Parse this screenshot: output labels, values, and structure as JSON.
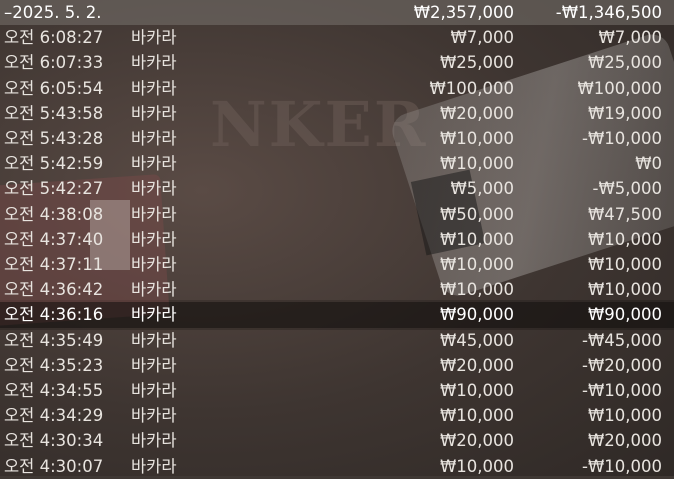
{
  "header": {
    "date": "–2025. 5. 2.",
    "bet_total": "₩2,357,000",
    "win_total": "-₩1,346,500"
  },
  "background_text": "NKER",
  "rows": [
    {
      "time": "오전 6:08:27",
      "game": "바카라",
      "bet": "₩7,000",
      "win": "₩7,000"
    },
    {
      "time": "오전 6:07:33",
      "game": "바카라",
      "bet": "₩25,000",
      "win": "₩25,000"
    },
    {
      "time": "오전 6:05:54",
      "game": "바카라",
      "bet": "₩100,000",
      "win": "₩100,000"
    },
    {
      "time": "오전 5:43:58",
      "game": "바카라",
      "bet": "₩20,000",
      "win": "₩19,000"
    },
    {
      "time": "오전 5:43:28",
      "game": "바카라",
      "bet": "₩10,000",
      "win": "-₩10,000"
    },
    {
      "time": "오전 5:42:59",
      "game": "바카라",
      "bet": "₩10,000",
      "win": "₩0"
    },
    {
      "time": "오전 5:42:27",
      "game": "바카라",
      "bet": "₩5,000",
      "win": "-₩5,000"
    },
    {
      "time": "오전 4:38:08",
      "game": "바카라",
      "bet": "₩50,000",
      "win": "₩47,500"
    },
    {
      "time": "오전 4:37:40",
      "game": "바카라",
      "bet": "₩10,000",
      "win": "₩10,000"
    },
    {
      "time": "오전 4:37:11",
      "game": "바카라",
      "bet": "₩10,000",
      "win": "₩10,000"
    },
    {
      "time": "오전 4:36:42",
      "game": "바카라",
      "bet": "₩10,000",
      "win": "₩10,000"
    },
    {
      "time": "오전 4:36:16",
      "game": "바카라",
      "bet": "₩90,000",
      "win": "₩90,000"
    },
    {
      "time": "오전 4:35:49",
      "game": "바카라",
      "bet": "₩45,000",
      "win": "-₩45,000"
    },
    {
      "time": "오전 4:35:23",
      "game": "바카라",
      "bet": "₩20,000",
      "win": "-₩20,000"
    },
    {
      "time": "오전 4:34:55",
      "game": "바카라",
      "bet": "₩10,000",
      "win": "-₩10,000"
    },
    {
      "time": "오전 4:34:29",
      "game": "바카라",
      "bet": "₩10,000",
      "win": "₩10,000"
    },
    {
      "time": "오전 4:30:34",
      "game": "바카라",
      "bet": "₩20,000",
      "win": "₩20,000"
    },
    {
      "time": "오전 4:30:07",
      "game": "바카라",
      "bet": "₩10,000",
      "win": "-₩10,000"
    }
  ]
}
